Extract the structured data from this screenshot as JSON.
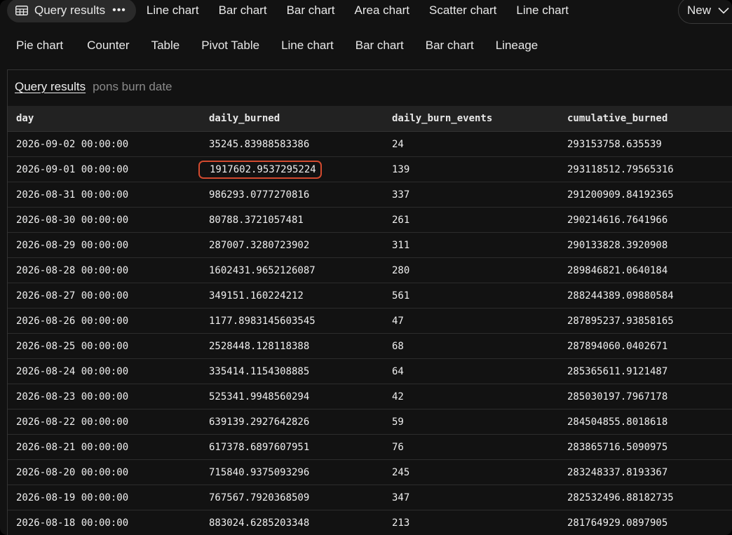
{
  "tabs_row1": {
    "active": {
      "label": "Query results",
      "icon": "table-icon",
      "more": "•••"
    },
    "items": [
      "Line chart",
      "Bar chart",
      "Bar chart",
      "Area chart",
      "Scatter chart",
      "Line chart"
    ],
    "new_label": "New"
  },
  "tabs_row2": {
    "items": [
      "Pie chart",
      "Counter",
      "Table",
      "Pivot Table",
      "Line chart",
      "Bar chart",
      "Bar chart",
      "Lineage"
    ]
  },
  "breadcrumb": {
    "link": "Query results",
    "subtitle": "pons burn date"
  },
  "table": {
    "columns": [
      "day",
      "daily_burned",
      "daily_burn_events",
      "cumulative_burned"
    ],
    "rows": [
      [
        "2026-09-02 00:00:00",
        "35245.83988583386",
        "24",
        "293153758.635539"
      ],
      [
        "2026-09-01 00:00:00",
        "1917602.9537295224",
        "139",
        "293118512.79565316"
      ],
      [
        "2026-08-31 00:00:00",
        "986293.0777270816",
        "337",
        "291200909.84192365"
      ],
      [
        "2026-08-30 00:00:00",
        "80788.3721057481",
        "261",
        "290214616.7641966"
      ],
      [
        "2026-08-29 00:00:00",
        "287007.3280723902",
        "311",
        "290133828.3920908"
      ],
      [
        "2026-08-28 00:00:00",
        "1602431.9652126087",
        "280",
        "289846821.0640184"
      ],
      [
        "2026-08-27 00:00:00",
        "349151.160224212",
        "561",
        "288244389.09880584"
      ],
      [
        "2026-08-26 00:00:00",
        "1177.8983145603545",
        "47",
        "287895237.93858165"
      ],
      [
        "2026-08-25 00:00:00",
        "2528448.128118388",
        "68",
        "287894060.0402671"
      ],
      [
        "2026-08-24 00:00:00",
        "335414.1154308885",
        "64",
        "285365611.9121487"
      ],
      [
        "2026-08-23 00:00:00",
        "525341.9948560294",
        "42",
        "285030197.7967178"
      ],
      [
        "2026-08-22 00:00:00",
        "639139.2927642826",
        "59",
        "284504855.8018618"
      ],
      [
        "2026-08-21 00:00:00",
        "617378.6897607951",
        "76",
        "283865716.5090975"
      ],
      [
        "2026-08-20 00:00:00",
        "715840.9375093296",
        "245",
        "283248337.8193367"
      ],
      [
        "2026-08-19 00:00:00",
        "767567.7920368509",
        "347",
        "282532496.88182735"
      ],
      [
        "2026-08-18 00:00:00",
        "883024.6285203348",
        "213",
        "281764929.0897905"
      ]
    ],
    "highlighted_cell": {
      "row": 1,
      "col": 1,
      "color": "#d24a2f"
    }
  },
  "colors": {
    "background": "#121212",
    "active_tab": "#2a2a2a",
    "header_row": "#222222",
    "highlight": "#d24a2f"
  }
}
